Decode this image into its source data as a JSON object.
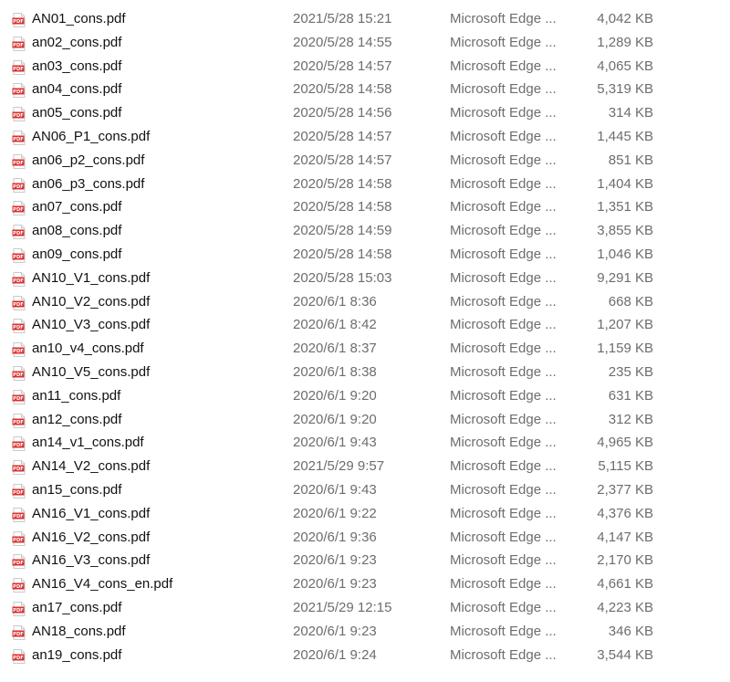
{
  "files": [
    {
      "name": "AN01_cons.pdf",
      "modified": "2021/5/28 15:21",
      "type": "Microsoft Edge ...",
      "size": "4,042 KB",
      "icon": "pdf-icon"
    },
    {
      "name": "an02_cons.pdf",
      "modified": "2020/5/28 14:55",
      "type": "Microsoft Edge ...",
      "size": "1,289 KB",
      "icon": "pdf-icon"
    },
    {
      "name": "an03_cons.pdf",
      "modified": "2020/5/28 14:57",
      "type": "Microsoft Edge ...",
      "size": "4,065 KB",
      "icon": "pdf-icon"
    },
    {
      "name": "an04_cons.pdf",
      "modified": "2020/5/28 14:58",
      "type": "Microsoft Edge ...",
      "size": "5,319 KB",
      "icon": "pdf-icon"
    },
    {
      "name": "an05_cons.pdf",
      "modified": "2020/5/28 14:56",
      "type": "Microsoft Edge ...",
      "size": "314 KB",
      "icon": "pdf-icon"
    },
    {
      "name": "AN06_P1_cons.pdf",
      "modified": "2020/5/28 14:57",
      "type": "Microsoft Edge ...",
      "size": "1,445 KB",
      "icon": "pdf-icon"
    },
    {
      "name": "an06_p2_cons.pdf",
      "modified": "2020/5/28 14:57",
      "type": "Microsoft Edge ...",
      "size": "851 KB",
      "icon": "pdf-icon"
    },
    {
      "name": "an06_p3_cons.pdf",
      "modified": "2020/5/28 14:58",
      "type": "Microsoft Edge ...",
      "size": "1,404 KB",
      "icon": "pdf-icon"
    },
    {
      "name": "an07_cons.pdf",
      "modified": "2020/5/28 14:58",
      "type": "Microsoft Edge ...",
      "size": "1,351 KB",
      "icon": "pdf-icon"
    },
    {
      "name": "an08_cons.pdf",
      "modified": "2020/5/28 14:59",
      "type": "Microsoft Edge ...",
      "size": "3,855 KB",
      "icon": "pdf-icon"
    },
    {
      "name": "an09_cons.pdf",
      "modified": "2020/5/28 14:58",
      "type": "Microsoft Edge ...",
      "size": "1,046 KB",
      "icon": "pdf-icon"
    },
    {
      "name": "AN10_V1_cons.pdf",
      "modified": "2020/5/28 15:03",
      "type": "Microsoft Edge ...",
      "size": "9,291 KB",
      "icon": "pdf-icon"
    },
    {
      "name": "AN10_V2_cons.pdf",
      "modified": "2020/6/1 8:36",
      "type": "Microsoft Edge ...",
      "size": "668 KB",
      "icon": "pdf-icon"
    },
    {
      "name": "AN10_V3_cons.pdf",
      "modified": "2020/6/1 8:42",
      "type": "Microsoft Edge ...",
      "size": "1,207 KB",
      "icon": "pdf-icon"
    },
    {
      "name": "an10_v4_cons.pdf",
      "modified": "2020/6/1 8:37",
      "type": "Microsoft Edge ...",
      "size": "1,159 KB",
      "icon": "pdf-icon"
    },
    {
      "name": "AN10_V5_cons.pdf",
      "modified": "2020/6/1 8:38",
      "type": "Microsoft Edge ...",
      "size": "235 KB",
      "icon": "pdf-icon"
    },
    {
      "name": "an11_cons.pdf",
      "modified": "2020/6/1 9:20",
      "type": "Microsoft Edge ...",
      "size": "631 KB",
      "icon": "pdf-icon"
    },
    {
      "name": "an12_cons.pdf",
      "modified": "2020/6/1 9:20",
      "type": "Microsoft Edge ...",
      "size": "312 KB",
      "icon": "pdf-icon"
    },
    {
      "name": "an14_v1_cons.pdf",
      "modified": "2020/6/1 9:43",
      "type": "Microsoft Edge ...",
      "size": "4,965 KB",
      "icon": "pdf-icon"
    },
    {
      "name": "AN14_V2_cons.pdf",
      "modified": "2021/5/29 9:57",
      "type": "Microsoft Edge ...",
      "size": "5,115 KB",
      "icon": "pdf-icon"
    },
    {
      "name": "an15_cons.pdf",
      "modified": "2020/6/1 9:43",
      "type": "Microsoft Edge ...",
      "size": "2,377 KB",
      "icon": "pdf-icon"
    },
    {
      "name": "AN16_V1_cons.pdf",
      "modified": "2020/6/1 9:22",
      "type": "Microsoft Edge ...",
      "size": "4,376 KB",
      "icon": "pdf-icon"
    },
    {
      "name": "AN16_V2_cons.pdf",
      "modified": "2020/6/1 9:36",
      "type": "Microsoft Edge ...",
      "size": "4,147 KB",
      "icon": "pdf-icon"
    },
    {
      "name": "AN16_V3_cons.pdf",
      "modified": "2020/6/1 9:23",
      "type": "Microsoft Edge ...",
      "size": "2,170 KB",
      "icon": "pdf-icon"
    },
    {
      "name": "AN16_V4_cons_en.pdf",
      "modified": "2020/6/1 9:23",
      "type": "Microsoft Edge ...",
      "size": "4,661 KB",
      "icon": "pdf-icon"
    },
    {
      "name": "an17_cons.pdf",
      "modified": "2021/5/29 12:15",
      "type": "Microsoft Edge ...",
      "size": "4,223 KB",
      "icon": "pdf-icon"
    },
    {
      "name": "AN18_cons.pdf",
      "modified": "2020/6/1 9:23",
      "type": "Microsoft Edge ...",
      "size": "346 KB",
      "icon": "pdf-icon"
    },
    {
      "name": "an19_cons.pdf",
      "modified": "2020/6/1 9:24",
      "type": "Microsoft Edge ...",
      "size": "3,544 KB",
      "icon": "pdf-icon"
    }
  ],
  "colors": {
    "pdf_icon_red": "#d9302f",
    "name_text": "#111111",
    "secondary_text": "#6d6d6d"
  }
}
